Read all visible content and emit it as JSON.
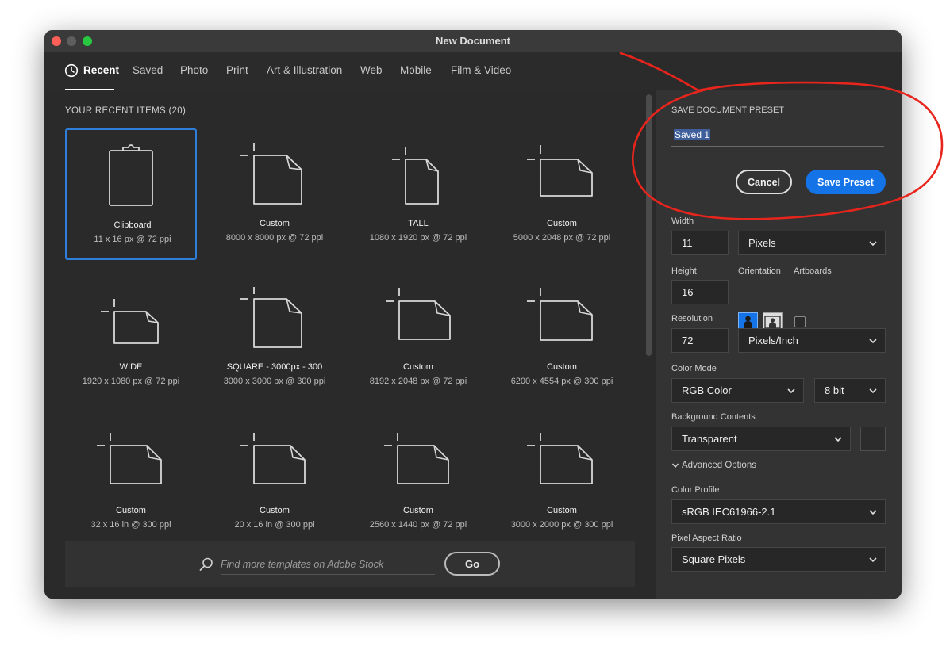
{
  "window": {
    "title": "New Document"
  },
  "tabs": [
    "Recent",
    "Saved",
    "Photo",
    "Print",
    "Art & Illustration",
    "Web",
    "Mobile",
    "Film & Video"
  ],
  "recent": {
    "header": "YOUR RECENT ITEMS",
    "count": "(20)",
    "items": [
      {
        "name": "Clipboard",
        "info": "11 x 16 px @ 72 ppi"
      },
      {
        "name": "Custom",
        "info": "8000 x 8000 px @ 72 ppi"
      },
      {
        "name": "TALL",
        "info": "1080 x 1920 px @ 72 ppi"
      },
      {
        "name": "Custom",
        "info": "5000 x 2048 px @ 72 ppi"
      },
      {
        "name": "WIDE",
        "info": "1920 x 1080 px @ 72 ppi"
      },
      {
        "name": "SQUARE - 3000px - 300",
        "info": "3000 x 3000 px @ 300 ppi"
      },
      {
        "name": "Custom",
        "info": "8192 x 2048 px @ 72 ppi"
      },
      {
        "name": "Custom",
        "info": "6200 x 4554 px @ 300 ppi"
      },
      {
        "name": "Custom",
        "info": "32 x 16 in @ 300 ppi"
      },
      {
        "name": "Custom",
        "info": "20 x 16 in @ 300 ppi"
      },
      {
        "name": "Custom",
        "info": "2560 x 1440 px @ 72 ppi"
      },
      {
        "name": "Custom",
        "info": "3000 x 2000 px @ 300 ppi"
      }
    ]
  },
  "search": {
    "placeholder": "Find more templates on Adobe Stock",
    "go_label": "Go"
  },
  "preset": {
    "heading": "SAVE DOCUMENT PRESET",
    "value": "Saved 1",
    "cancel_label": "Cancel",
    "save_label": "Save Preset"
  },
  "settings": {
    "width_label": "Width",
    "width_value": "11",
    "width_unit": "Pixels",
    "height_label": "Height",
    "height_value": "16",
    "orientation_label": "Orientation",
    "orientation_selected": "portrait",
    "artboards_label": "Artboards",
    "artboards_checked": false,
    "resolution_label": "Resolution",
    "resolution_value": "72",
    "resolution_unit": "Pixels/Inch",
    "color_mode_label": "Color Mode",
    "color_mode": "RGB Color",
    "bit_depth": "8 bit",
    "background_label": "Background Contents",
    "background_value": "Transparent",
    "advanced_label": "Advanced Options",
    "color_profile_label": "Color Profile",
    "color_profile_value": "sRGB IEC61966-2.1",
    "pixel_aspect_label": "Pixel Aspect Ratio",
    "pixel_aspect_value": "Square Pixels"
  },
  "colors": {
    "accent": "#1473e6",
    "annotation": "#e8251c",
    "selection_border": "#2f7edb"
  }
}
